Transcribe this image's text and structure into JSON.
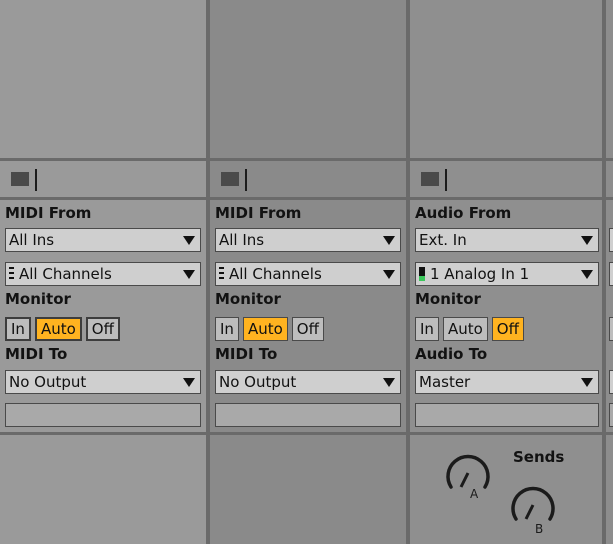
{
  "tracks": [
    {
      "input_label": "MIDI From",
      "input_source": "All Ins",
      "input_channel": "All Channels",
      "monitor_label": "Monitor",
      "monitor_options": [
        "In",
        "Auto",
        "Off"
      ],
      "monitor_selected": "Auto",
      "output_label": "MIDI To",
      "output_target": "No Output"
    },
    {
      "input_label": "MIDI From",
      "input_source": "All Ins",
      "input_channel": "All Channels",
      "monitor_label": "Monitor",
      "monitor_options": [
        "In",
        "Auto",
        "Off"
      ],
      "monitor_selected": "Auto",
      "output_label": "MIDI To",
      "output_target": "No Output"
    },
    {
      "input_label": "Audio From",
      "input_source": "Ext. In",
      "input_channel": "1 Analog In 1",
      "monitor_label": "Monitor",
      "monitor_options": [
        "In",
        "Auto",
        "Off"
      ],
      "monitor_selected": "Off",
      "output_label": "Audio To",
      "output_target": "Master",
      "sends_label": "Sends",
      "send_labels": [
        "A",
        "B"
      ]
    }
  ],
  "colors": {
    "monitor_active": "#ffb320",
    "meter_green": "#3ac75a"
  },
  "icons": {
    "clip_stop": "stop-square-icon",
    "dropdown": "triangle-down-icon",
    "knob": "send-knob-icon"
  }
}
